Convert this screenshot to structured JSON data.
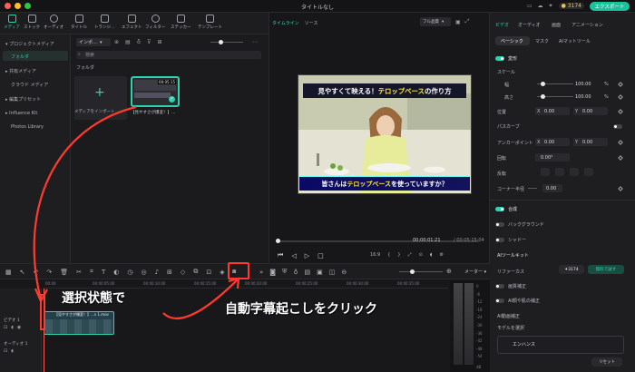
{
  "window": {
    "title": "タイトルなし",
    "export_label": "エクスポート",
    "credits": "3174"
  },
  "toolbar": {
    "tools": [
      {
        "label": "メディア",
        "icon": "media-icon",
        "active": true
      },
      {
        "label": "ストック",
        "icon": "stock-icon"
      },
      {
        "label": "オーディオ",
        "icon": "audio-icon"
      },
      {
        "label": "タイトル",
        "icon": "title-icon"
      },
      {
        "label": "トランジ…",
        "icon": "transition-icon"
      },
      {
        "label": "エフェクト",
        "icon": "effect-icon"
      },
      {
        "label": "フィルター",
        "icon": "filter-icon"
      },
      {
        "label": "ステッカー",
        "icon": "sticker-icon"
      },
      {
        "label": "テンプレート",
        "icon": "template-icon"
      }
    ]
  },
  "sidebar": {
    "items": [
      {
        "label": "▾ プロジェクトメディア"
      },
      {
        "label": "フォルダ",
        "selected": true
      },
      {
        "label": "▸ 共有メディア"
      },
      {
        "label": "クラウド メディア"
      },
      {
        "label": "▸ 編集プリセット"
      },
      {
        "label": "▸ Influence Kit"
      },
      {
        "label": "Photos Library"
      }
    ]
  },
  "media": {
    "import_label": "インポ…",
    "search_placeholder": "検索",
    "folder_label": "フォルダ",
    "import_item_label": "メディアをインポート",
    "clip_label": "【見やすさが爆変！】…",
    "clip_duration": "00:05:15"
  },
  "preview": {
    "tabs": [
      "タイムライン",
      "ソース"
    ],
    "quality": "フル品質",
    "caption_top_pre": "見やすくて映える！",
    "caption_top_hl": "テロップベース",
    "caption_top_post": "の作り方",
    "caption_bottom_pre": "皆さんは",
    "caption_bottom_hl": "テロップベース",
    "caption_bottom_post": "を使っていますか？",
    "time_current": "00:00:01:21",
    "time_total": "/ 00:05:15:04",
    "ratio": "16:9"
  },
  "inspector": {
    "tabs": [
      "ビデオ",
      "オーディオ",
      "画面",
      "アニメーション"
    ],
    "subtabs": [
      "ベーシック",
      "マスク",
      "AIマットツール"
    ],
    "transform_label": "変形",
    "scale_label": "スケール",
    "width_label": "幅",
    "height_label": "高さ",
    "scale_w": "100.00",
    "scale_h": "100.00",
    "pct": "%",
    "position_label": "位置",
    "pos_x_label": "X",
    "pos_x": "0.00",
    "pos_y_label": "Y",
    "pos_y": "0.00",
    "path_label": "パスカーブ",
    "anchor_label": "アンカーポイント",
    "anchor_x": "0.00",
    "anchor_y": "0.00",
    "rotate_label": "回転",
    "rotate_value": "0.00°",
    "flip_label": "反転",
    "corner_label": "コーナー半径",
    "corner_value": "0.00",
    "composite_label": "合成",
    "background_label": "バックグラウンド",
    "shadow_label": "シャドー",
    "ai_tools_label": "AIツールキット",
    "refine_label": "リファーカス",
    "refine_credits": "3174",
    "refine_try": "無料で試す",
    "denoise_label": "画質補正",
    "ai_beauty_label": "AI顔や肌の補正",
    "ai_enhance_label": "AI動画補正",
    "model_label": "モデルを選択",
    "enhance_label": "エンハンス",
    "reset_label": "リセット"
  },
  "timeline": {
    "ticks": [
      "00:00",
      "00:00:05:00",
      "00:00:10:00",
      "00:00:15:00",
      "00:00:20:00",
      "00:00:25:00",
      "00:00:30:00",
      "00:00:35:00"
    ],
    "track_video": "ビデオ 1",
    "track_audio": "オーディオ 1",
    "clip_label": "【見やすさが爆変！】…s 1.mov",
    "meter_label": "メーター",
    "meter_scale": [
      "0",
      "-6",
      "-12",
      "-18",
      "-24",
      "-30",
      "-36",
      "-42",
      "-48",
      "-54"
    ],
    "meter_db": "dB"
  },
  "annotations": {
    "select_state": "選択状態で",
    "auto_caption": "自動字幕起こしをクリック"
  },
  "colors": {
    "accent": "#2fd1b0",
    "annotation": "#ff3b30",
    "export": "#19c39a"
  }
}
